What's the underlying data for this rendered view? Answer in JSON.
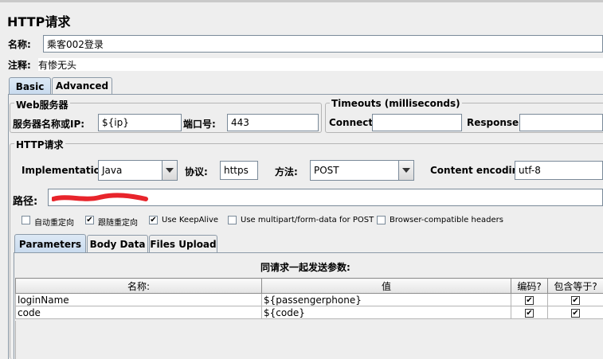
{
  "title": "HTTP请求",
  "name_label": "名称:",
  "name_value": "乘客002登录",
  "comment_label": "注释:",
  "comment_value": "有惨无头",
  "tabs": [
    {
      "label": "Basic"
    },
    {
      "label": "Advanced"
    }
  ],
  "web_server": {
    "title": "Web服务器",
    "server_label": "服务器名称或IP:",
    "server_value": "${ip}",
    "port_label": "端口号:",
    "port_value": "443"
  },
  "timeouts": {
    "title": "Timeouts (milliseconds)",
    "connect_label": "Connect:",
    "connect_value": "",
    "response_label": "Response:",
    "response_value": ""
  },
  "http_request": {
    "title": "HTTP请求",
    "implementation_label": "Implementation:",
    "implementation_value": "Java",
    "protocol_label": "协议:",
    "protocol_value": "https",
    "method_label": "方法:",
    "method_value": "POST",
    "encoding_label": "Content encoding:",
    "encoding_value": "utf-8",
    "path_label": "路径:"
  },
  "checkboxes": [
    {
      "label": "自动重定向",
      "checked": false
    },
    {
      "label": "跟随重定向",
      "checked": true
    },
    {
      "label": "Use KeepAlive",
      "checked": true
    },
    {
      "label": "Use multipart/form-data for POST",
      "checked": false
    },
    {
      "label": "Browser-compatible headers",
      "checked": false
    }
  ],
  "sub_tabs": [
    {
      "label": "Parameters"
    },
    {
      "label": "Body Data"
    },
    {
      "label": "Files Upload"
    }
  ],
  "params": {
    "caption": "同请求一起发送参数:",
    "headers": {
      "name": "名称:",
      "value": "值",
      "encode": "编码?",
      "include_equals": "包含等于?"
    },
    "rows": [
      {
        "name": "loginName",
        "value": "${passengerphone}",
        "encode": true,
        "include_equals": true
      },
      {
        "name": "code",
        "value": "${code}",
        "encode": true,
        "include_equals": true
      }
    ]
  },
  "colors": {
    "redaction": "#e8242b",
    "selected_tab": "#c8daee"
  }
}
